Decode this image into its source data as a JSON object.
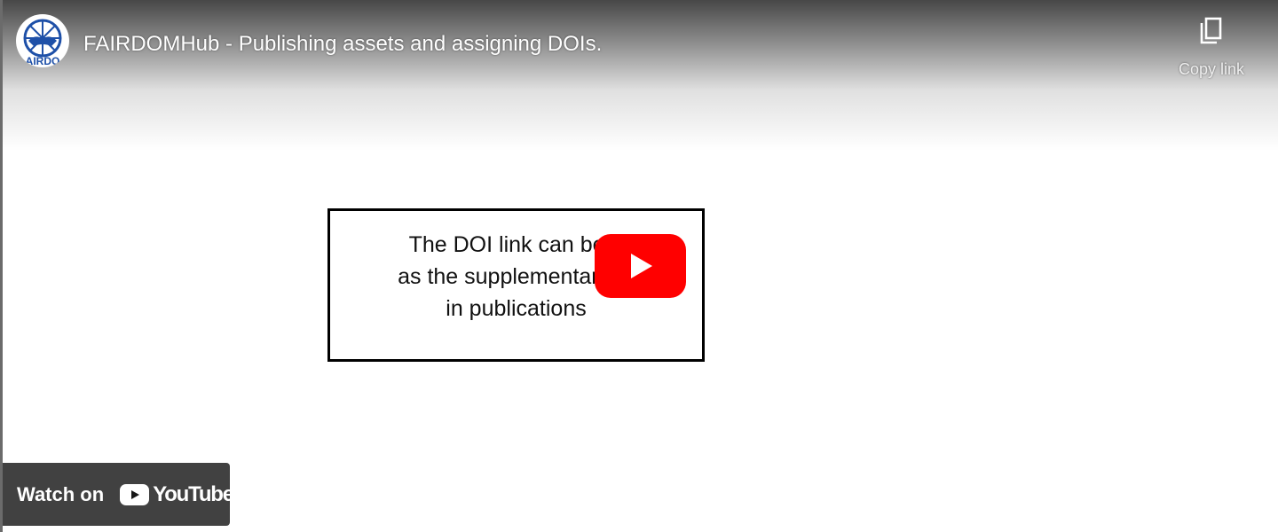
{
  "player": {
    "title": "FAIRDOMHub - Publishing assets and assigning DOIs.",
    "channel": {
      "avatar_text": "AIRDO"
    },
    "copy_link": {
      "label": "Copy link",
      "icon": "copy-icon"
    },
    "play_button": {
      "icon": "play-icon"
    }
  },
  "slide": {
    "lines": [
      "The DOI link can be u",
      "as the supplementary m",
      "in publications"
    ]
  },
  "watch_on": {
    "label": "Watch on",
    "brand": "YouTube"
  },
  "colors": {
    "play_red": "#ff0000",
    "bar_bg": "#171717",
    "avatar_blue": "#1e50a8"
  }
}
